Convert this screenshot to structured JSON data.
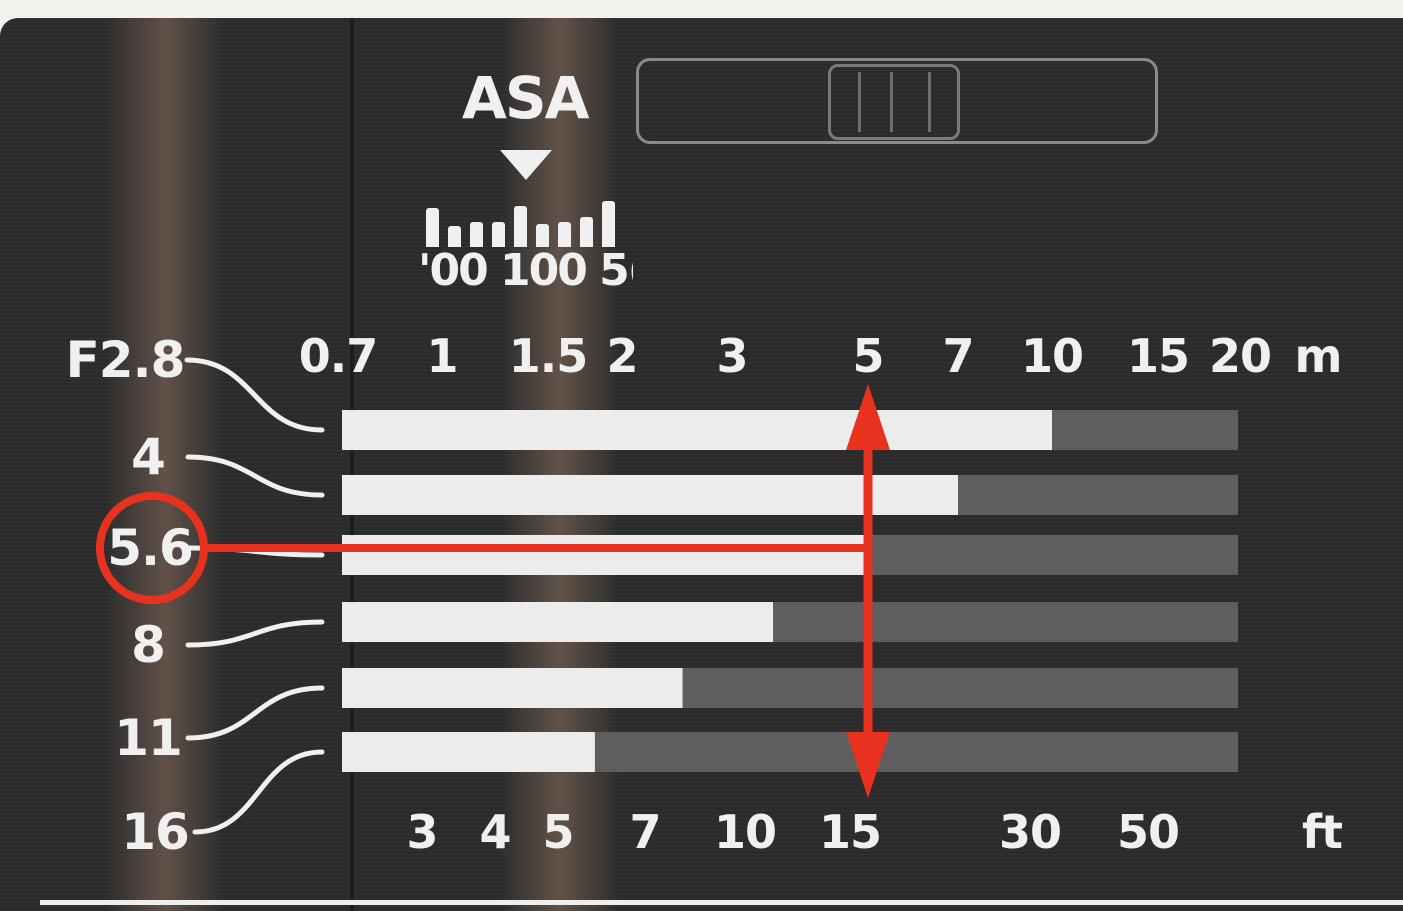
{
  "asa": {
    "title": "ASA",
    "values_text": "'00 100 5(",
    "bar_levels": [
      0.85,
      0.45,
      0.55,
      0.55,
      0.9,
      0.5,
      0.55,
      0.65,
      1.0
    ]
  },
  "chart_data": {
    "type": "bar",
    "title": "",
    "top_axis": {
      "ticks": [
        "0.7",
        "1",
        "1.5",
        "2",
        "3",
        "5",
        "7",
        "10",
        "15",
        "20"
      ],
      "unit": "m"
    },
    "bottom_axis": {
      "ticks": [
        "3",
        "4",
        "5",
        "7",
        "10",
        "15",
        "30",
        "50"
      ],
      "unit": "ft"
    },
    "apertures": [
      "F2.8",
      "4",
      "5.6",
      "8",
      "11",
      "16"
    ],
    "highlighted_aperture": "5.6",
    "highlighted_distance_m": "5",
    "highlighted_distance_ft": "15",
    "series": [
      {
        "aperture": "F2.8",
        "sharp_until_m": 10
      },
      {
        "aperture": "4",
        "sharp_until_m": 7
      },
      {
        "aperture": "5.6",
        "sharp_until_m": 5
      },
      {
        "aperture": "8",
        "sharp_until_m": 3.5
      },
      {
        "aperture": "11",
        "sharp_until_m": 2.5
      },
      {
        "aperture": "16",
        "sharp_until_m": 1.8
      }
    ],
    "x_scale": "log",
    "xlim_m": [
      0.7,
      20
    ],
    "colors": {
      "sharp": "#ececec",
      "unsharp": "#5e5e5e",
      "highlight": "#e8321e",
      "text": "#f0f0f0",
      "background": "#2b2b2b"
    }
  }
}
